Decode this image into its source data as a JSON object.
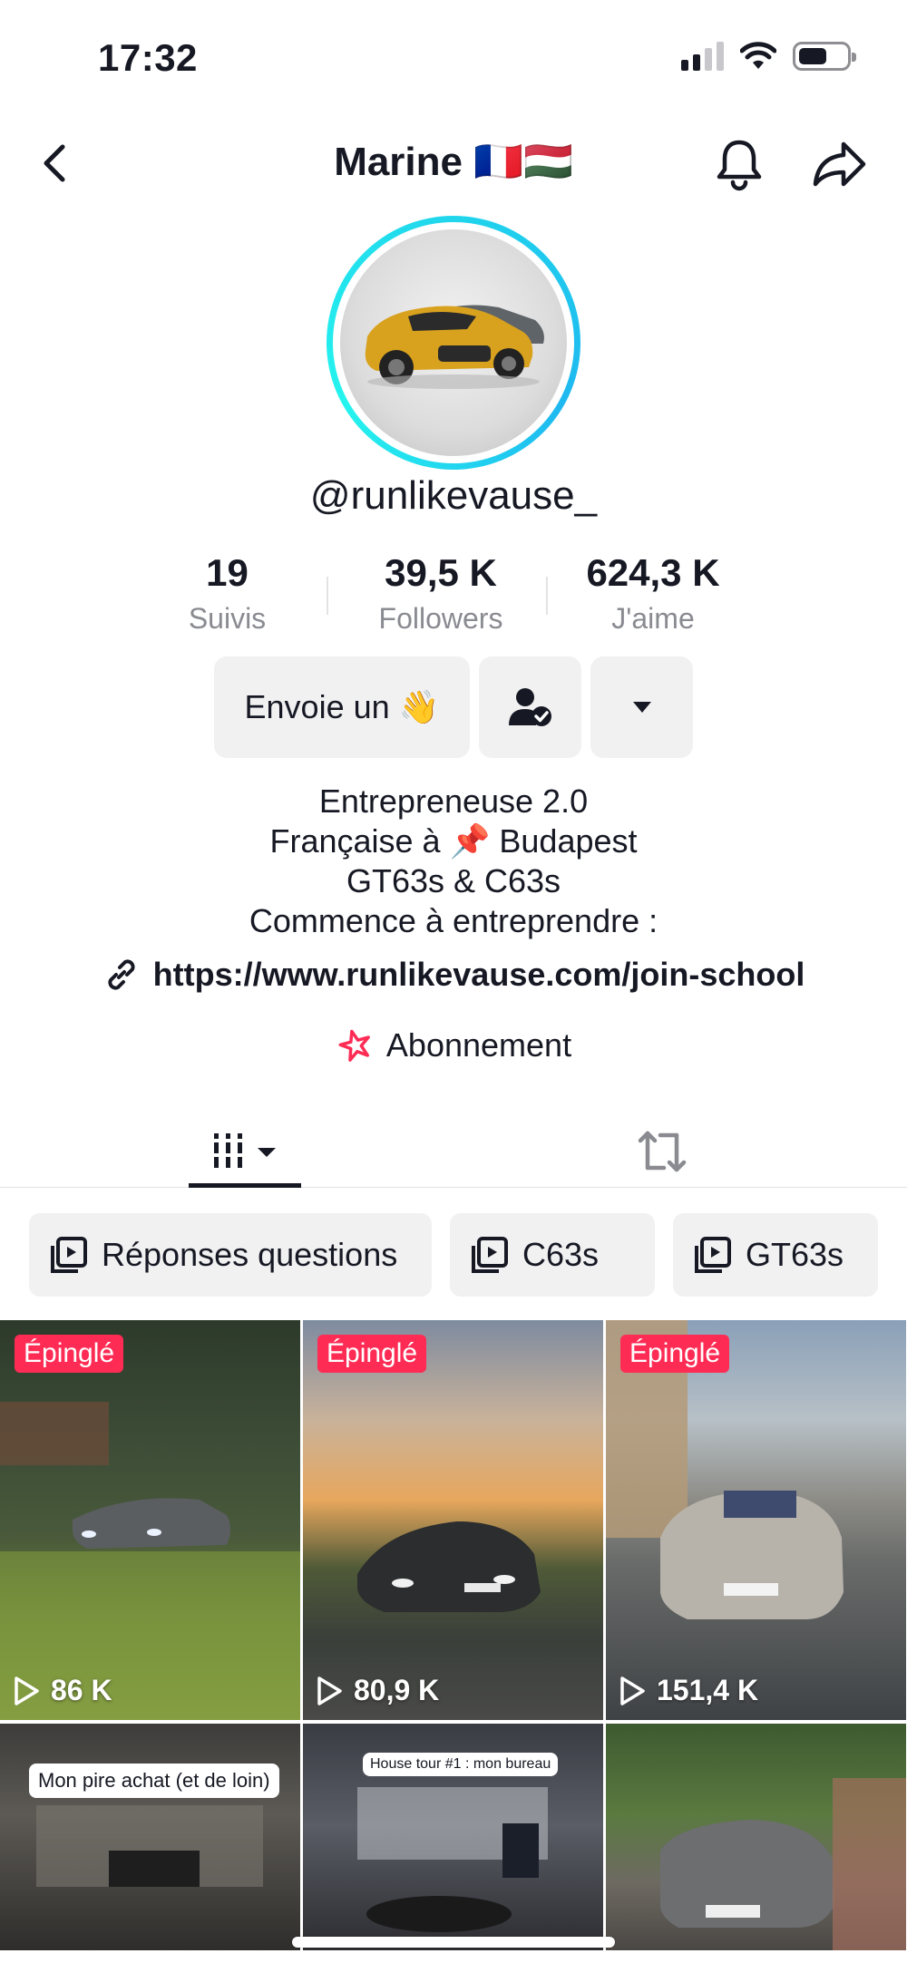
{
  "status_bar": {
    "time": "17:32"
  },
  "header": {
    "title": "Marine 🇫🇷🇭🇺"
  },
  "profile": {
    "username": "@runlikevause_",
    "stats": [
      {
        "value": "19",
        "label": "Suivis"
      },
      {
        "value": "39,5 K",
        "label": "Followers"
      },
      {
        "value": "624,3 K",
        "label": "J'aime"
      }
    ],
    "message_button": "Envoie un 👋",
    "bio": [
      "Entrepreneuse 2.0",
      "Française à 📌 Budapest",
      "GT63s & C63s",
      "Commence à entreprendre :"
    ],
    "link": "https://www.runlikevause.com/join-school",
    "subscription": "Abonnement"
  },
  "playlists": [
    {
      "label": "Réponses questions"
    },
    {
      "label": "C63s"
    },
    {
      "label": "GT63s"
    }
  ],
  "videos": [
    {
      "pinned": "Épinglé",
      "views": "86 K",
      "caption": ""
    },
    {
      "pinned": "Épinglé",
      "views": "80,9 K",
      "caption": ""
    },
    {
      "pinned": "Épinglé",
      "views": "151,4 K",
      "caption": ""
    },
    {
      "pinned": "",
      "views": "",
      "caption": "Mon pire achat (et de loin)"
    },
    {
      "pinned": "",
      "views": "",
      "caption": "House tour #1 : mon bureau"
    },
    {
      "pinned": "",
      "views": "",
      "caption": ""
    }
  ],
  "colors": {
    "accent": "#fe2c55",
    "ring": "#20d5ec",
    "text": "#161823",
    "muted": "#8a8b91",
    "button_bg": "#f1f1f2"
  }
}
